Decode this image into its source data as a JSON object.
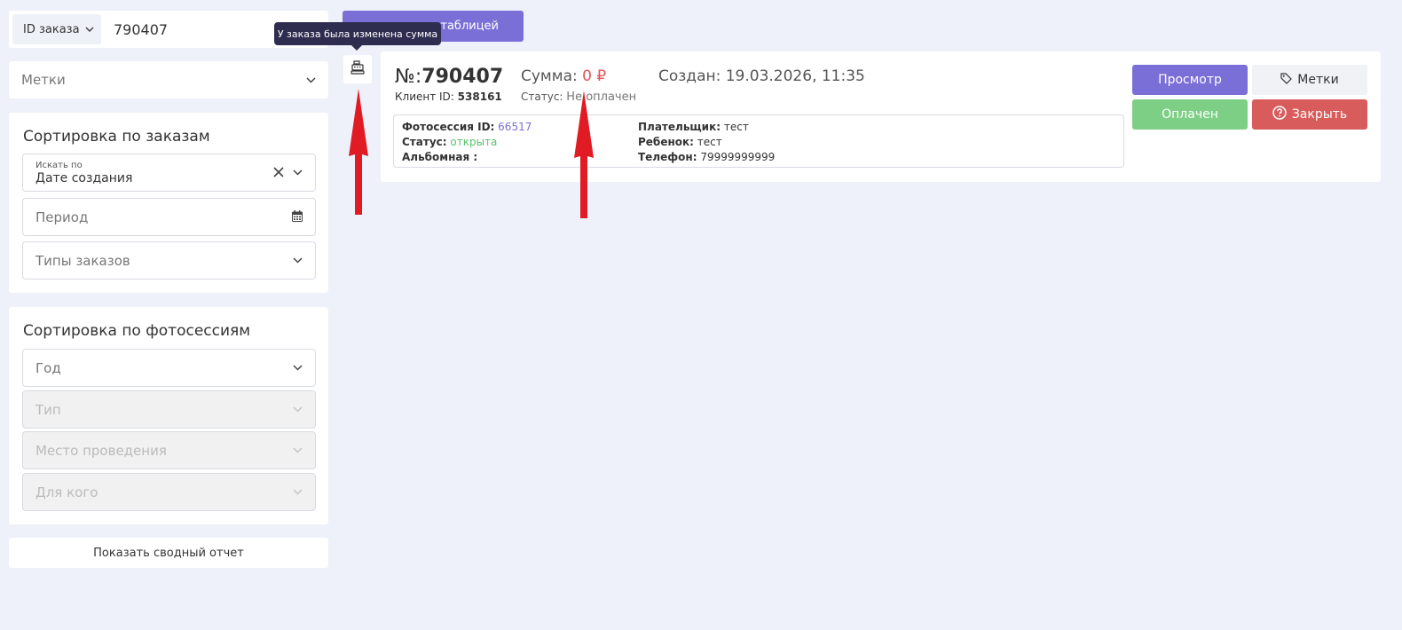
{
  "search": {
    "type_label": "ID заказа",
    "value": "790407"
  },
  "filters": {
    "labels_placeholder": "Метки"
  },
  "sort_orders": {
    "title": "Сортировка по заказам",
    "search_by_label": "Искать по",
    "search_by_value": "Дате создания",
    "period_placeholder": "Период",
    "order_types_placeholder": "Типы заказов"
  },
  "sort_photos": {
    "title": "Сортировка по фотосессиям",
    "year": "Год",
    "type": "Тип",
    "location": "Место проведения",
    "for_whom": "Для кого"
  },
  "summary_report_label": "Показать сводный отчет",
  "table_button_label": "таблицей",
  "tooltip_text": "У заказа была изменена сумма",
  "order": {
    "number_prefix": "№:",
    "number": "790407",
    "client_label": "Клиент ID:",
    "client_id": "538161",
    "sum_label": "Сумма:",
    "sum_value": "0 ₽",
    "status_label": "Статус:",
    "status_value": "Не оплачен",
    "created": "Создан: 19.03.2026, 11:35",
    "details": {
      "photosession_label": "Фотосессия ID:",
      "photosession_id": "66517",
      "status_label": "Статус:",
      "status_value": "открыта",
      "album_label": "Альбомная :",
      "payer_label": "Плательщик:",
      "payer_value": "тест",
      "child_label": "Ребенок:",
      "child_value": "тест",
      "phone_label": "Телефон:",
      "phone_value": "79999999999"
    },
    "buttons": {
      "view": "Просмотр",
      "tags": "Метки",
      "paid": "Оплачен",
      "close": "Закрыть"
    }
  },
  "colors": {
    "accent": "#7a6fd6",
    "success": "#7dcf85",
    "danger": "#d95c5c",
    "arrow": "#e01b24"
  }
}
